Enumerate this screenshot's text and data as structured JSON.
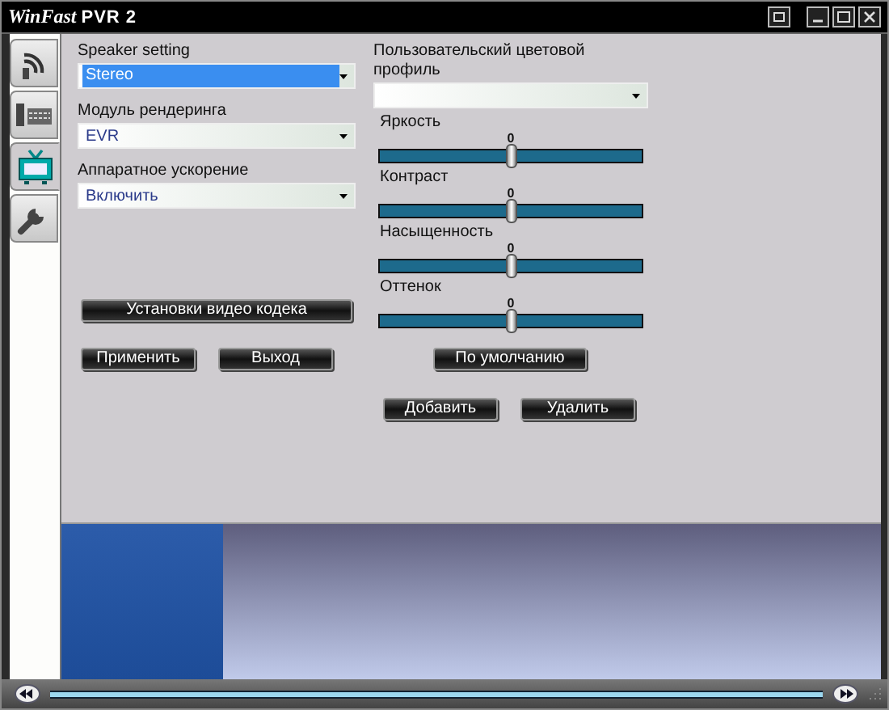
{
  "window": {
    "brand": "WinFast",
    "product": "PVR 2"
  },
  "tabs": [
    {
      "kind": "antenna",
      "selected": false
    },
    {
      "kind": "keyboard",
      "selected": false
    },
    {
      "kind": "tv",
      "selected": true
    },
    {
      "kind": "wrench",
      "selected": false
    }
  ],
  "left_fields": [
    {
      "label": "Speaker setting",
      "value": "Stereo",
      "highlighted": true
    },
    {
      "label": "Модуль рендеринга",
      "value": "EVR",
      "highlighted": false
    },
    {
      "label": "Аппаратное ускорение",
      "value": "Включить",
      "highlighted": false
    }
  ],
  "codec_button": "Установки видео кодека",
  "left_buttons": [
    "Применить",
    "Выход"
  ],
  "color_profile": {
    "label": "Пользовательский цветовой профиль"
  },
  "sliders": [
    {
      "label": "Яркость",
      "reading": "0",
      "level": 0.5
    },
    {
      "label": "Контраст",
      "reading": "0",
      "level": 0.5
    },
    {
      "label": "Насыщенность",
      "reading": "0",
      "level": 0.5
    },
    {
      "label": "Оттенок",
      "reading": "0",
      "level": 0.5
    }
  ],
  "default_button": "По умолчанию",
  "profile_buttons": [
    "Добавить",
    "Удалить"
  ]
}
